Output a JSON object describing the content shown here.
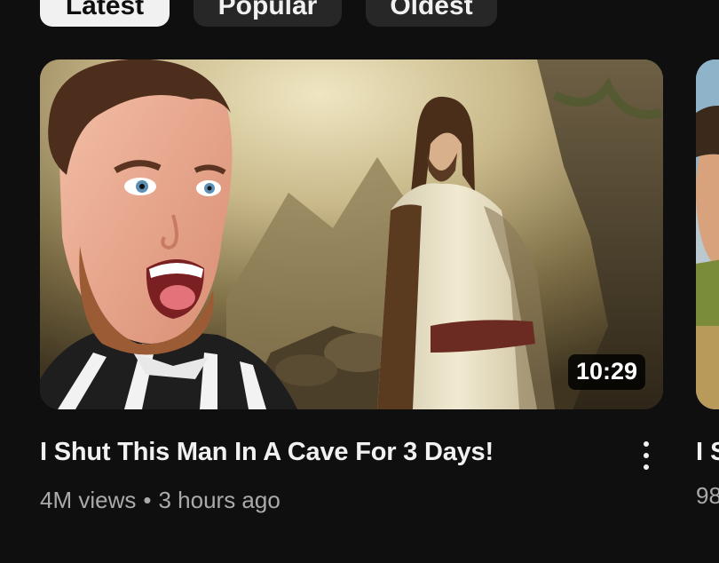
{
  "filter_chips": [
    {
      "label": "Latest",
      "active": true
    },
    {
      "label": "Popular",
      "active": false
    },
    {
      "label": "Oldest",
      "active": false
    }
  ],
  "video": {
    "title": "I Shut This Man In A Cave For 3 Days!",
    "views": "4M views",
    "separator": "•",
    "age": "3 hours ago",
    "duration": "10:29",
    "more_icon": "more-vert-icon"
  },
  "next_video": {
    "title_fragment": "I S",
    "sub_fragment": "98"
  },
  "colors": {
    "background": "#0f0f0f",
    "chip_active_bg": "#f1f1f1",
    "chip_bg": "#272727",
    "text_primary": "#f1f1f1",
    "text_secondary": "#aaaaaa"
  }
}
